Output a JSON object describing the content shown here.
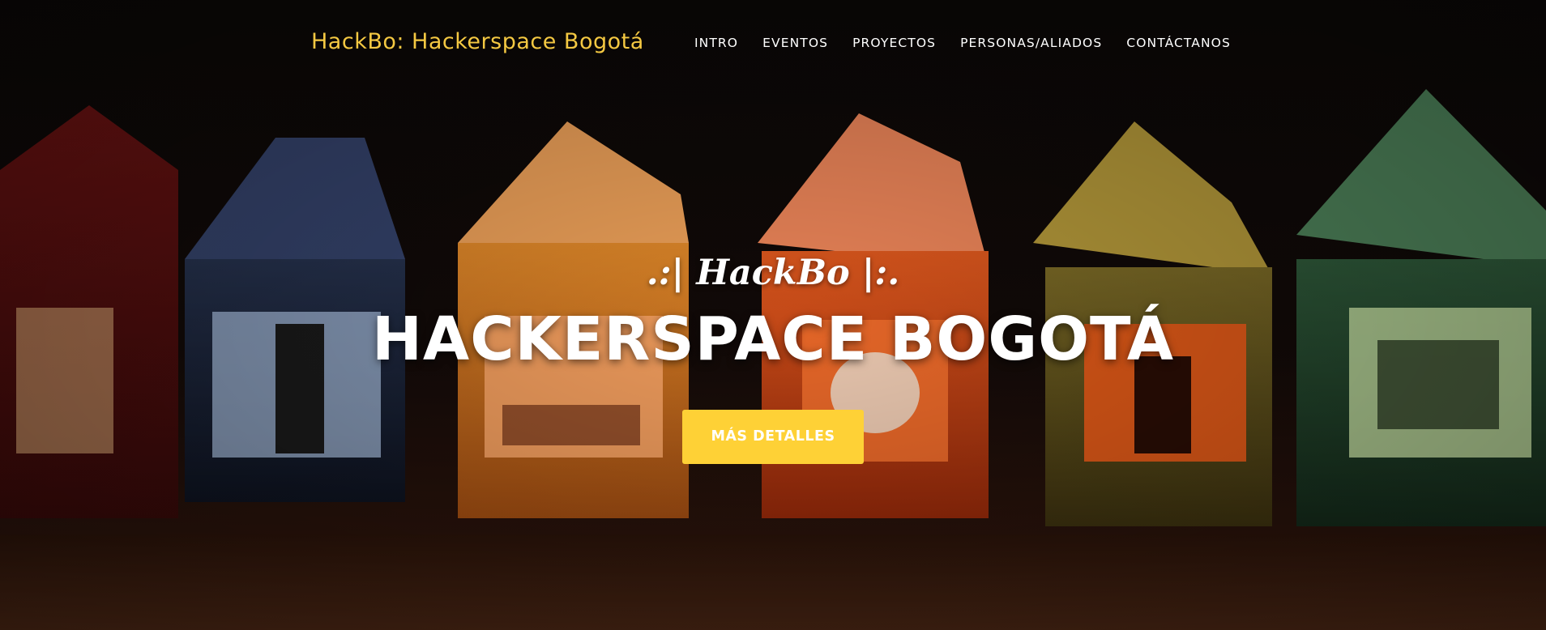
{
  "navbar": {
    "brand": "HackBo: Hackerspace Bogotá",
    "items": [
      {
        "label": "INTRO"
      },
      {
        "label": "EVENTOS"
      },
      {
        "label": "PROYECTOS"
      },
      {
        "label": "PERSONAS/ALIADOS"
      },
      {
        "label": "CONTÁCTANOS"
      }
    ]
  },
  "hero": {
    "subheading": ".:| HackBo |:.",
    "heading": "HACKERSPACE BOGOTÁ",
    "cta_label": "MÁS DETALLES",
    "background_image": "paper-lanterns-photo"
  },
  "colors": {
    "brand": "#f4c842",
    "cta_background": "#fed136",
    "text": "#ffffff"
  }
}
